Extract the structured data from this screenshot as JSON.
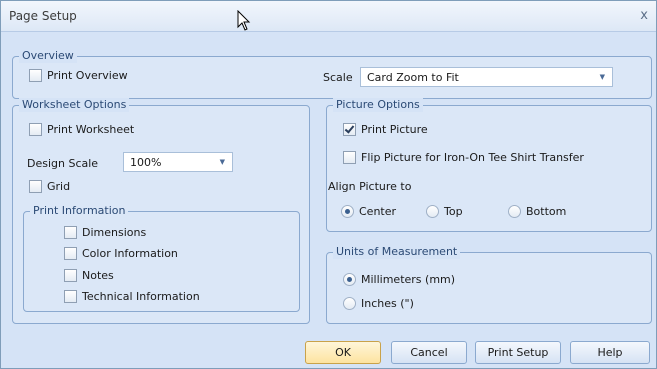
{
  "window": {
    "title": "Page Setup",
    "close_glyph": "x"
  },
  "overview": {
    "title": "Overview",
    "print_overview": {
      "label": "Print Overview",
      "checked": false
    },
    "scale_label": "Scale",
    "scale_value": "Card Zoom to Fit"
  },
  "worksheet_options": {
    "title": "Worksheet Options",
    "print_worksheet": {
      "label": "Print Worksheet",
      "checked": false
    },
    "design_scale_label": "Design Scale",
    "design_scale_value": "100%",
    "grid": {
      "label": "Grid",
      "checked": false
    },
    "print_information": {
      "title": "Print Information",
      "items": [
        {
          "label": "Dimensions",
          "checked": false
        },
        {
          "label": "Color Information",
          "checked": false
        },
        {
          "label": "Notes",
          "checked": false
        },
        {
          "label": "Technical Information",
          "checked": false
        }
      ]
    }
  },
  "picture_options": {
    "title": "Picture Options",
    "print_picture": {
      "label": "Print Picture",
      "checked": true
    },
    "flip_picture": {
      "label": "Flip Picture for Iron-On Tee Shirt Transfer",
      "checked": false
    },
    "align_label": "Align Picture to",
    "align_options": [
      {
        "label": "Center",
        "selected": true
      },
      {
        "label": "Top",
        "selected": false
      },
      {
        "label": "Bottom",
        "selected": false
      }
    ]
  },
  "units": {
    "title": "Units of Measurement",
    "options": [
      {
        "label": "Millimeters (mm)",
        "selected": true
      },
      {
        "label": "Inches (\")",
        "selected": false
      }
    ]
  },
  "buttons": {
    "ok": "OK",
    "cancel": "Cancel",
    "print_setup": "Print Setup",
    "help": "Help"
  },
  "colors": {
    "dialog_bg": "#d5e3f6",
    "group_border": "#8ba9cf",
    "title_text": "#2b4a75",
    "default_button": "#fde3a0"
  }
}
